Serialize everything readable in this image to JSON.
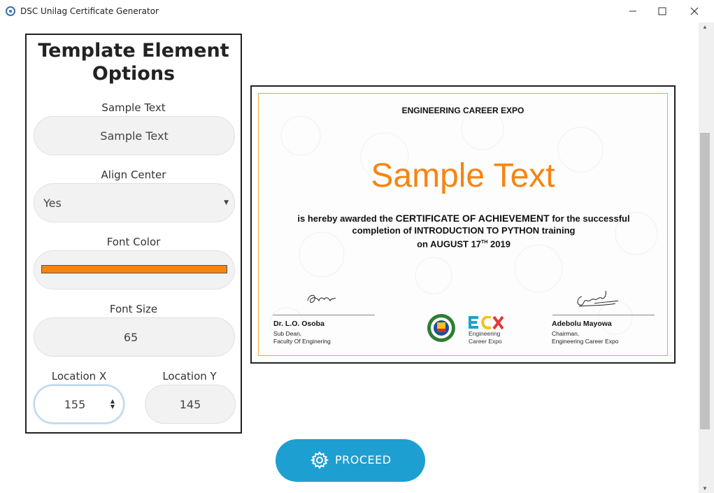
{
  "window": {
    "title": "DSC Unilag Certificate Generator",
    "minimize_icon": "minimize-icon",
    "maximize_icon": "maximize-icon",
    "close_icon": "close-icon"
  },
  "panel": {
    "title_line1": "Template Element",
    "title_line2": "Options",
    "sample_text": {
      "label": "Sample Text",
      "value": "Sample Text"
    },
    "align_center": {
      "label": "Align Center",
      "value": "Yes"
    },
    "font_color": {
      "label": "Font Color",
      "value": "#f68512"
    },
    "font_size": {
      "label": "Font Size",
      "value": "65"
    },
    "location_x": {
      "label": "Location X",
      "value": "155"
    },
    "location_y": {
      "label": "Location Y",
      "value": "145"
    }
  },
  "certificate": {
    "title": "ENGINEERING CAREER EXPO",
    "sample_text": "Sample Text",
    "body_line1_a": "is hereby awarded the ",
    "body_line1_b": "CERTIFICATE OF ACHIEVEMENT",
    "body_line1_c": " for the successful",
    "body_line2": "completion of INTRODUCTION TO PYTHON training",
    "body_line3_a": "on AUGUST 17",
    "body_line3_sup": "TH",
    "body_line3_b": " 2019",
    "signer_left": {
      "name": "Dr. L.O. Osoba",
      "role1": "Sub Dean,",
      "role2": "Faculty Of Enginering"
    },
    "signer_right": {
      "name": "Adebolu Mayowa",
      "role1": "Chairman,",
      "role2": "Engineering Career Expo"
    },
    "ecx_logo": {
      "line1": "Engineering",
      "line2": "Career Expo"
    },
    "accent_color": "#f68512"
  },
  "proceed_button": {
    "label": "PROCEED",
    "icon": "gear-icon",
    "color": "#1e9fd2"
  }
}
